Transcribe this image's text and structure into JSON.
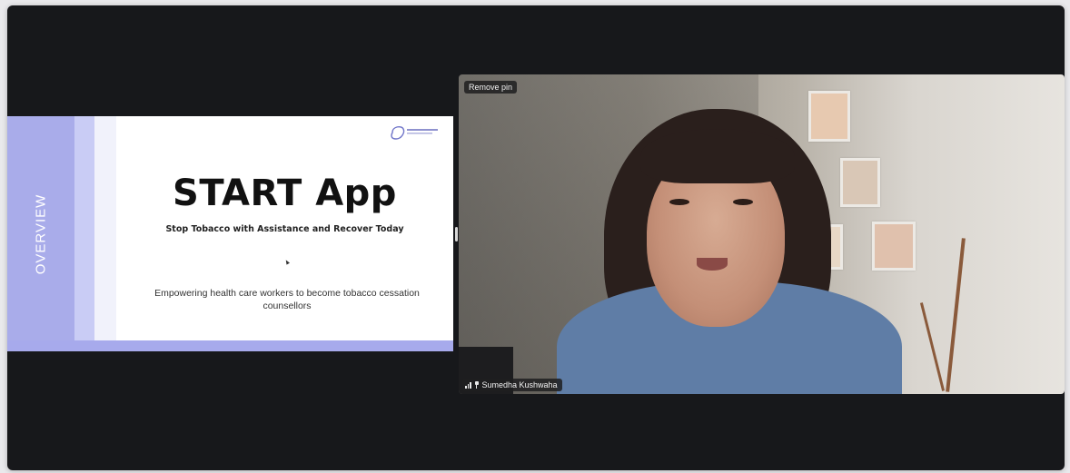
{
  "shared_slide": {
    "side_label": "OVERVIEW",
    "title": "START App",
    "subtitle": "Stop Tobacco with Assistance and Recover Today",
    "tagline": "Empowering health care workers to become tobacco cessation counsellors",
    "logo_icon": "global-health-logo-icon"
  },
  "video_tile": {
    "remove_pin_label": "Remove pin",
    "participant_name": "Sumedha Kushwaha",
    "signal_icon": "signal-strength-icon",
    "pin_icon": "pin-icon"
  },
  "colors": {
    "stage_background": "#17181b",
    "slide_accent": "#a9acea",
    "slide_accent_light": "#c9ccf5"
  }
}
